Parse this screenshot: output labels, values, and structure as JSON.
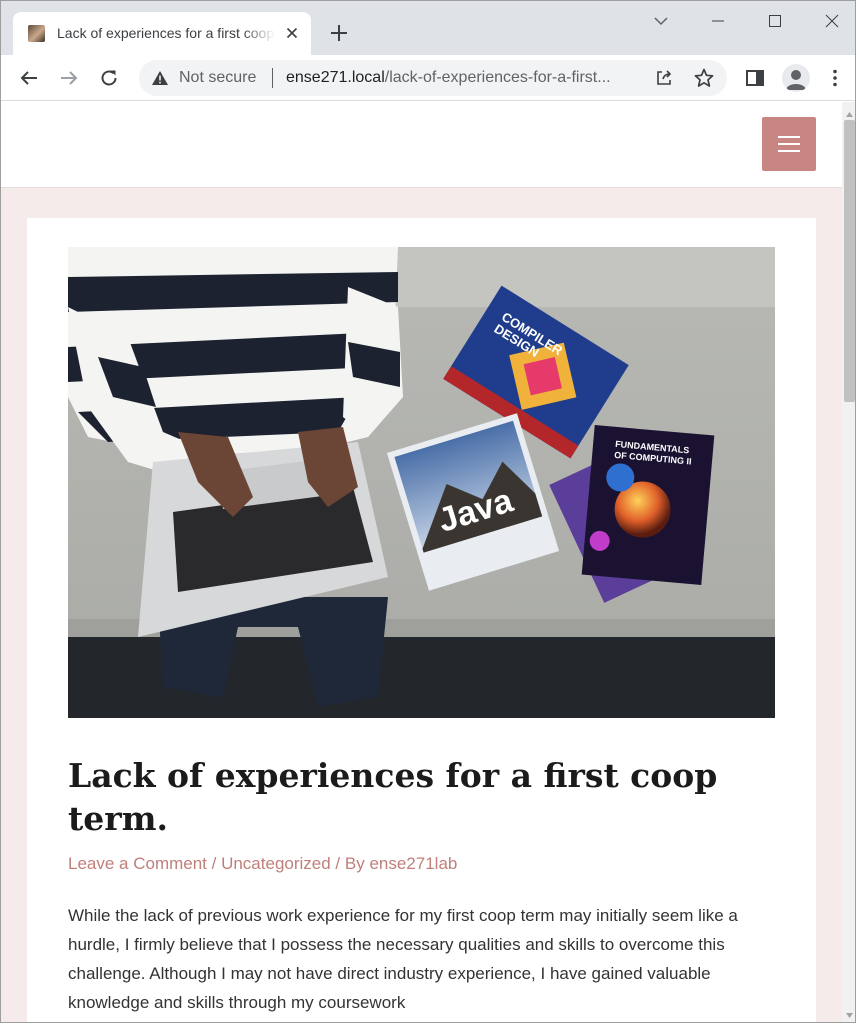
{
  "browser": {
    "tab": {
      "title": "Lack of experiences for a first coop term.",
      "favicon": "site-favicon"
    },
    "new_tab_icon": "plus-icon",
    "window_controls": [
      "minimize-icon",
      "maximize-icon",
      "close-icon"
    ],
    "omnibox": {
      "security_label": "Not secure",
      "host": "ense271.local",
      "path": "/lack-of-experiences-for-a-first..."
    }
  },
  "site": {
    "menu_toggle_icon": "hamburger-menu-icon",
    "accent_color": "#c98582"
  },
  "post": {
    "title": "Lack of experiences for a first coop term.",
    "meta": {
      "comments": "Leave a Comment",
      "sep1": " / ",
      "category": "Uncategorized",
      "sep2": " / By ",
      "author": "ense271lab"
    },
    "body": "While the lack of previous work experience for my first coop term may initially seem like a hurdle, I firmly believe that I possess the necessary qualities and skills to overcome this challenge. Although I may not have direct industry experience, I have gained valuable knowledge and skills through my coursework",
    "image": {
      "book1_line1": "COMPILER",
      "book1_line2": "DESIGN",
      "book2_title": "Java",
      "book3_line1": "FUNDAMENTALS",
      "book3_line2": "OF COMPUTING II"
    }
  }
}
